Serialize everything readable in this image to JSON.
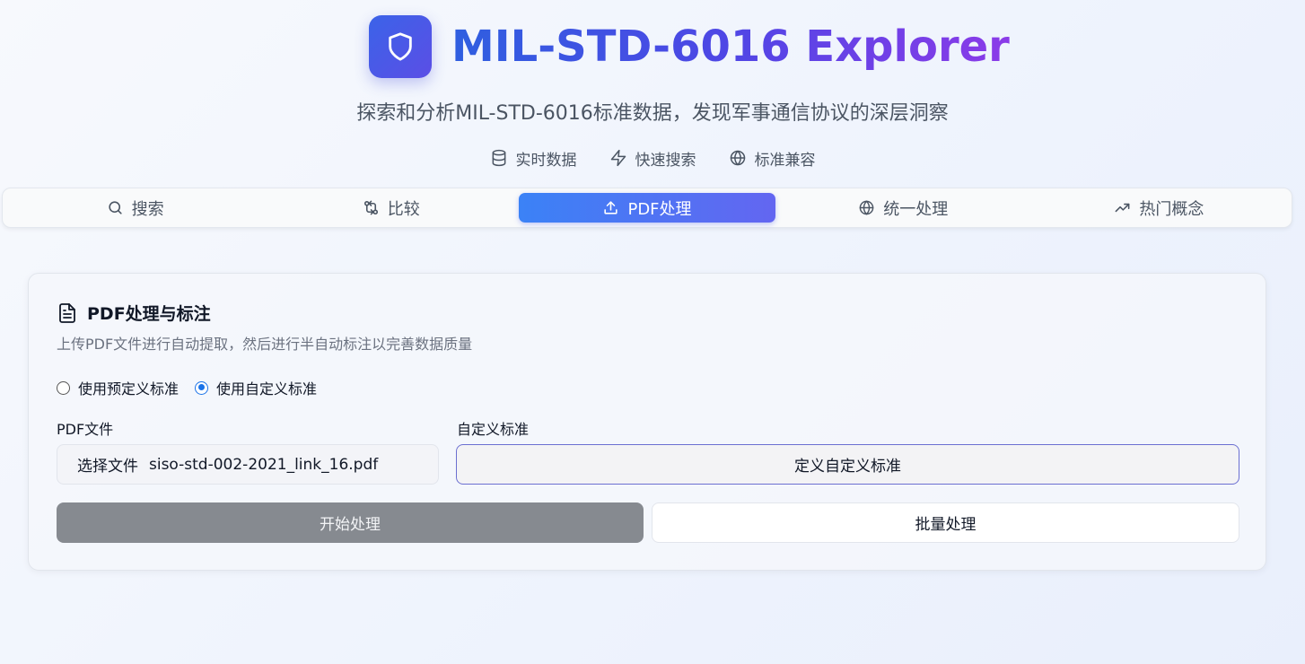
{
  "header": {
    "title": "MIL-STD-6016 Explorer",
    "subtitle": "探索和分析MIL-STD-6016标准数据，发现军事通信协议的深层洞察",
    "logo_icon": "shield-icon",
    "features": [
      {
        "icon": "database-icon",
        "label": "实时数据"
      },
      {
        "icon": "lightning-icon",
        "label": "快速搜索"
      },
      {
        "icon": "globe-icon",
        "label": "标准兼容"
      }
    ]
  },
  "tabs": [
    {
      "icon": "search-icon",
      "label": "搜索",
      "active": false
    },
    {
      "icon": "compare-icon",
      "label": "比较",
      "active": false
    },
    {
      "icon": "upload-icon",
      "label": "PDF处理",
      "active": true
    },
    {
      "icon": "globe-icon",
      "label": "统一处理",
      "active": false
    },
    {
      "icon": "trending-icon",
      "label": "热门概念",
      "active": false
    }
  ],
  "panel": {
    "title": "PDF处理与标注",
    "description": "上传PDF文件进行自动提取，然后进行半自动标注以完善数据质量",
    "radio_predefined": "使用预定义标准",
    "radio_custom": "使用自定义标准",
    "selected_radio": "custom",
    "pdf_label": "PDF文件",
    "choose_file": "选择文件",
    "file_name": "siso-std-002-2021_link_16.pdf",
    "custom_label": "自定义标准",
    "define_button": "定义自定义标准",
    "start_button": "开始处理",
    "batch_button": "批量处理"
  },
  "colors": {
    "accent_start": "#3b82f6",
    "accent_end": "#6366f1",
    "disabled_button": "#868a90"
  }
}
